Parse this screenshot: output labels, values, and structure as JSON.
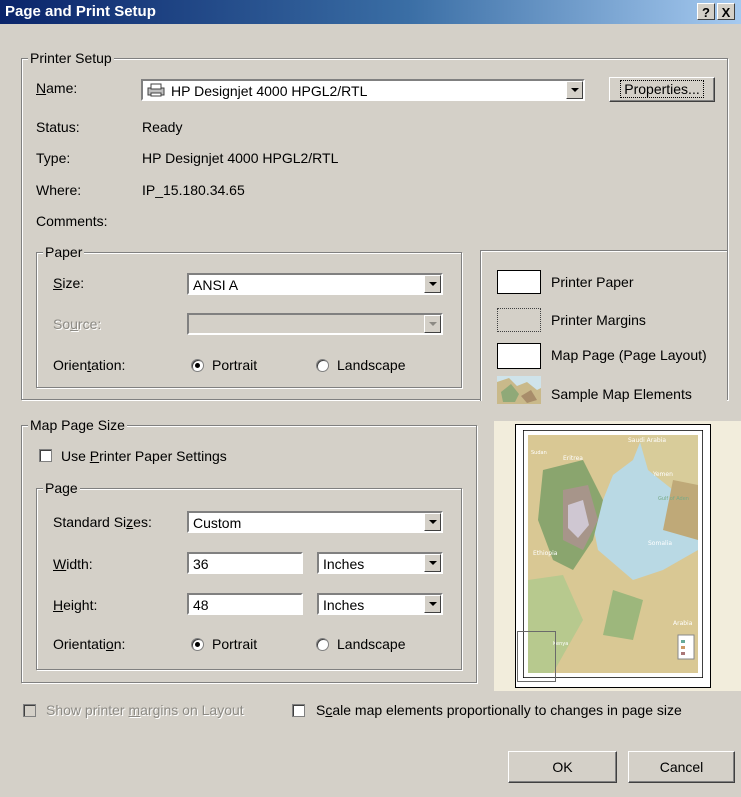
{
  "window": {
    "title": "Page and Print Setup",
    "help": "?",
    "close": "X"
  },
  "printer_setup": {
    "legend": "Printer Setup",
    "name_label": "Name:",
    "name_value": "HP Designjet 4000 HPGL2/RTL",
    "properties_button": "Properties...",
    "status_label": "Status:",
    "status_value": "Ready",
    "type_label": "Type:",
    "type_value": "HP Designjet 4000 HPGL2/RTL",
    "where_label": "Where:",
    "where_value": "IP_15.180.34.65",
    "comments_label": "Comments:"
  },
  "paper": {
    "legend": "Paper",
    "size_label": "Size:",
    "size_value": "ANSI A",
    "source_label": "Source:",
    "source_value": "",
    "orientation_label": "Orientation:",
    "portrait": "Portrait",
    "landscape": "Landscape",
    "selected": "Portrait"
  },
  "legend_panel": {
    "printer_paper": "Printer Paper",
    "printer_margins": "Printer Margins",
    "map_page": "Map Page (Page Layout)",
    "sample_map": "Sample Map Elements"
  },
  "map_page_size": {
    "legend": "Map Page Size",
    "use_printer_paper": "Use Printer Paper Settings",
    "use_printer_paper_checked": false
  },
  "page": {
    "legend": "Page",
    "standard_sizes_label": "Standard Sizes:",
    "standard_sizes_value": "Custom",
    "width_label": "Width:",
    "width_value": "36",
    "width_unit": "Inches",
    "height_label": "Height:",
    "height_value": "48",
    "height_unit": "Inches",
    "orientation_label": "Orientation:",
    "portrait": "Portrait",
    "landscape": "Landscape",
    "selected": "Portrait"
  },
  "preview_labels": [
    "Saudi Arabia",
    "Eritrea",
    "Sudan",
    "Yemen",
    "Gulf of Aden",
    "Ethiopia",
    "Somalia",
    "Kenya",
    "Arabia"
  ],
  "bottom": {
    "show_margins": "Show printer margins on Layout",
    "show_margins_checked": false,
    "scale_elements": "Scale map elements proportionally to changes in page size",
    "scale_elements_checked": false,
    "ok": "OK",
    "cancel": "Cancel"
  },
  "colors": {
    "titlebar_start": "#0a246a",
    "titlebar_end": "#a6caf0",
    "face": "#d4d0c8"
  }
}
